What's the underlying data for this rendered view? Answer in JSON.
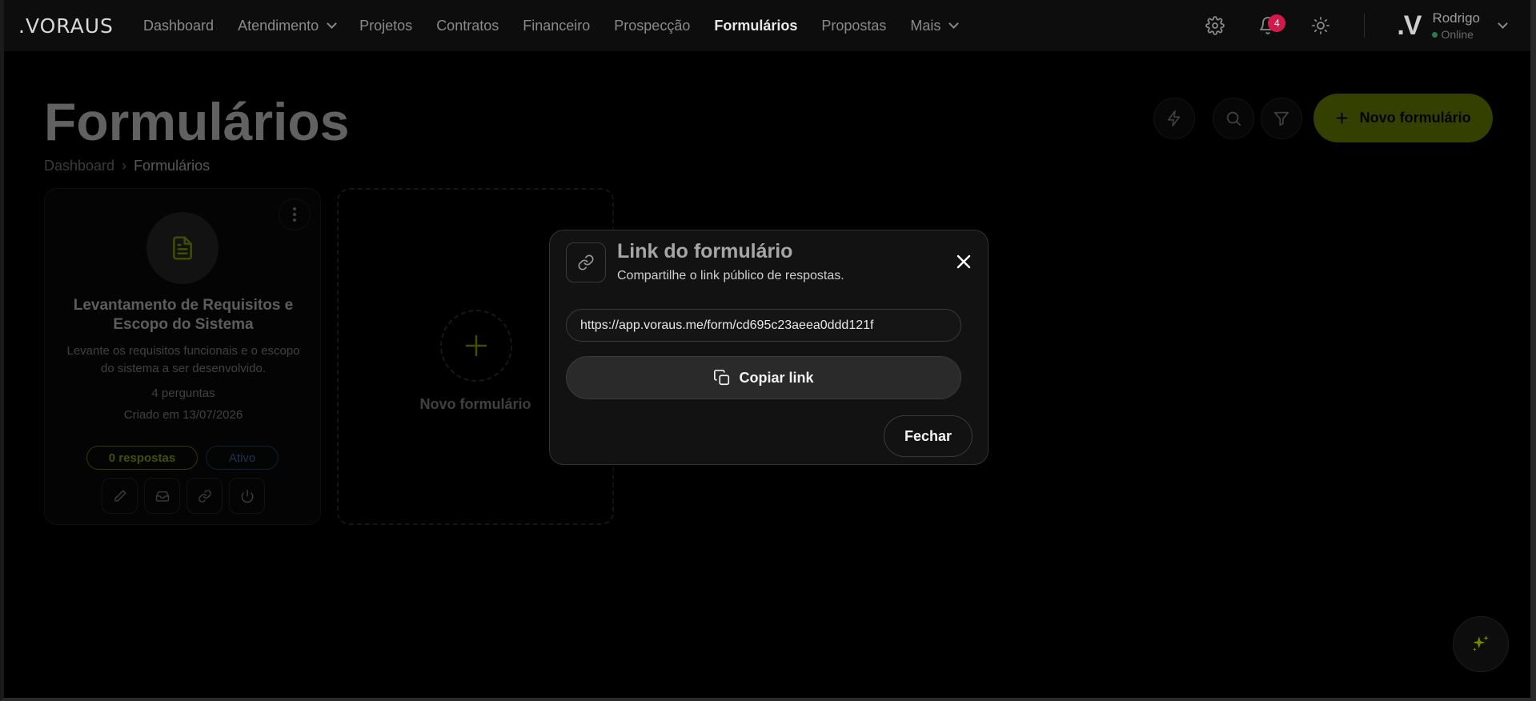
{
  "app": {
    "logo": ".VORAUS"
  },
  "nav": {
    "items": [
      {
        "label": "Dashboard"
      },
      {
        "label": "Atendimento"
      },
      {
        "label": "Projetos"
      },
      {
        "label": "Contratos"
      },
      {
        "label": "Financeiro"
      },
      {
        "label": "Prospecção"
      },
      {
        "label": "Formulários"
      },
      {
        "label": "Propostas"
      },
      {
        "label": "Mais"
      }
    ],
    "notifications_count": "4",
    "user": {
      "avatar": ".V",
      "name": "Rodrigo",
      "status": "Online"
    }
  },
  "page": {
    "title": "Formulários",
    "breadcrumb": {
      "home": "Dashboard",
      "separator": "›",
      "current": "Formulários"
    },
    "new_button_label": "Novo formulário"
  },
  "form_card": {
    "title": "Levantamento de Requisitos e Escopo do Sistema",
    "description": "Levante os requisitos funcionais e o escopo do sistema a ser desenvolvido.",
    "questions": "4 perguntas",
    "created": "Criado em 13/07/2026",
    "responses_badge": "0 respostas",
    "status_badge": "Ativo"
  },
  "new_card": {
    "label": "Novo formulário"
  },
  "modal": {
    "title": "Link do formulário",
    "subtitle": "Compartilhe o link público de respostas.",
    "link": "https://app.voraus.me/form/cd695c23aeea0ddd121f",
    "copy_label": "Copiar link",
    "close_label": "Fechar"
  },
  "colors": {
    "accent": "#7d9900",
    "badge": "#d11a4a",
    "status_blue": "#4a78b8"
  }
}
